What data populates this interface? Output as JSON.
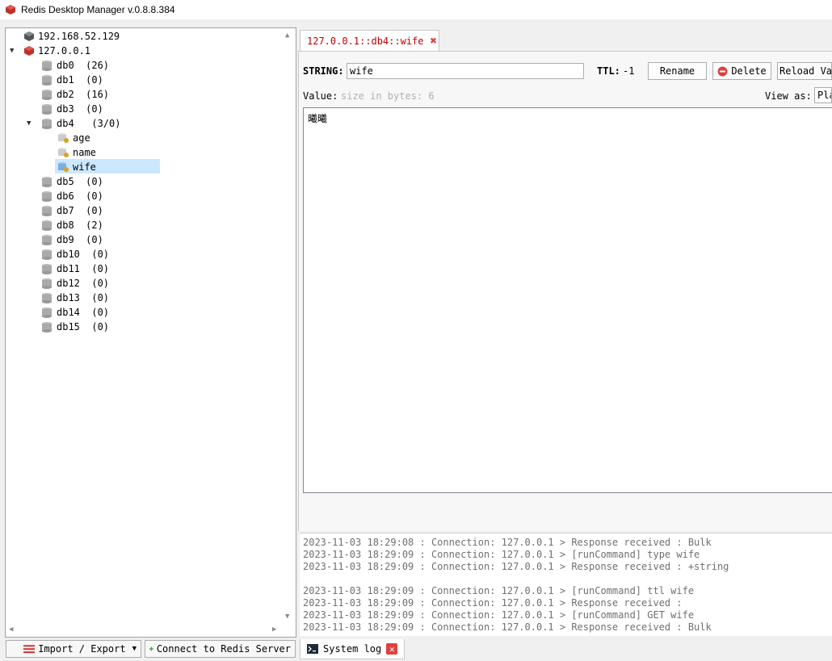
{
  "window": {
    "title": "Redis Desktop Manager v.0.8.8.384"
  },
  "colors": {
    "accent": "#c00000",
    "selection": "#cce8ff"
  },
  "tree": {
    "servers": [
      {
        "label": "192.168.52.129",
        "expanded": false
      },
      {
        "label": "127.0.0.1",
        "expanded": true
      }
    ],
    "databases": [
      {
        "label": "db0  (26)"
      },
      {
        "label": "db1  (0)"
      },
      {
        "label": "db2  (16)"
      },
      {
        "label": "db3  (0)"
      },
      {
        "label": "db4   (3/0)",
        "expanded": true
      },
      {
        "label": "db5  (0)"
      },
      {
        "label": "db6  (0)"
      },
      {
        "label": "db7  (0)"
      },
      {
        "label": "db8  (2)"
      },
      {
        "label": "db9  (0)"
      },
      {
        "label": "db10  (0)"
      },
      {
        "label": "db11  (0)"
      },
      {
        "label": "db12  (0)"
      },
      {
        "label": "db13  (0)"
      },
      {
        "label": "db14  (0)"
      },
      {
        "label": "db15  (0)"
      }
    ],
    "keys": [
      {
        "label": "age"
      },
      {
        "label": "name"
      },
      {
        "label": "wife",
        "selected": true
      }
    ]
  },
  "bottom_buttons": {
    "import_export": "Import / Export",
    "connect": "Connect to Redis Server"
  },
  "tab": {
    "label": "127.0.0.1::db4::wife"
  },
  "key_editor": {
    "type_label": "STRING:",
    "key_name": "wife",
    "ttl_label": "TTL:",
    "ttl_value": "-1",
    "rename": "Rename",
    "delete": "Delete",
    "reload": "Reload Val",
    "value_label": "Value:",
    "size_hint": "size in bytes: 6",
    "view_as_label": "View as:",
    "view_as_value": "Pla",
    "value": "曦曦"
  },
  "log": {
    "lines": [
      "2023-11-03 18:29:08 : Connection: 127.0.0.1 > Response received : Bulk",
      "2023-11-03 18:29:09 : Connection: 127.0.0.1 > [runCommand] type wife",
      "2023-11-03 18:29:09 : Connection: 127.0.0.1 > Response received : +string",
      "",
      "2023-11-03 18:29:09 : Connection: 127.0.0.1 > [runCommand] ttl wife",
      "2023-11-03 18:29:09 : Connection: 127.0.0.1 > Response received :",
      "2023-11-03 18:29:09 : Connection: 127.0.0.1 > [runCommand] GET wife",
      "2023-11-03 18:29:09 : Connection: 127.0.0.1 > Response received : Bulk"
    ],
    "tab_label": "System log"
  }
}
